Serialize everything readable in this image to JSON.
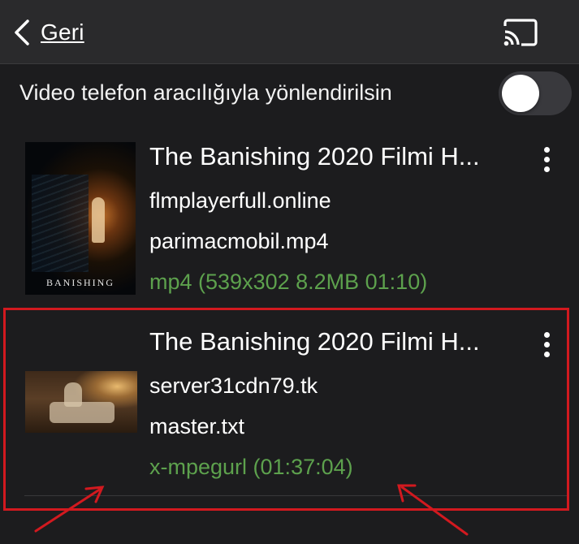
{
  "header": {
    "back_label": "Geri",
    "back_icon": "chevron-left-icon",
    "cast_icon": "cast-icon"
  },
  "toggle": {
    "label": "Video telefon aracılığıyla yönlendirilsin",
    "state": "off"
  },
  "items": [
    {
      "title": "The Banishing 2020 Filmi H...",
      "domain": "flmplayerfull.online",
      "filename": "parimacmobil.mp4",
      "meta": "mp4 (539x302 8.2MB 01:10)",
      "thumbnail_text": "BANISHING",
      "menu_icon": "more-vertical-icon"
    },
    {
      "title": "The Banishing 2020 Filmi H...",
      "domain": "server31cdn79.tk",
      "filename": "master.txt",
      "meta": "x-mpegurl (01:37:04)",
      "menu_icon": "more-vertical-icon"
    }
  ],
  "colors": {
    "background": "#1c1c1e",
    "header": "#2a2a2c",
    "meta_green": "#5da14d",
    "annotation_red": "#d2191f"
  }
}
